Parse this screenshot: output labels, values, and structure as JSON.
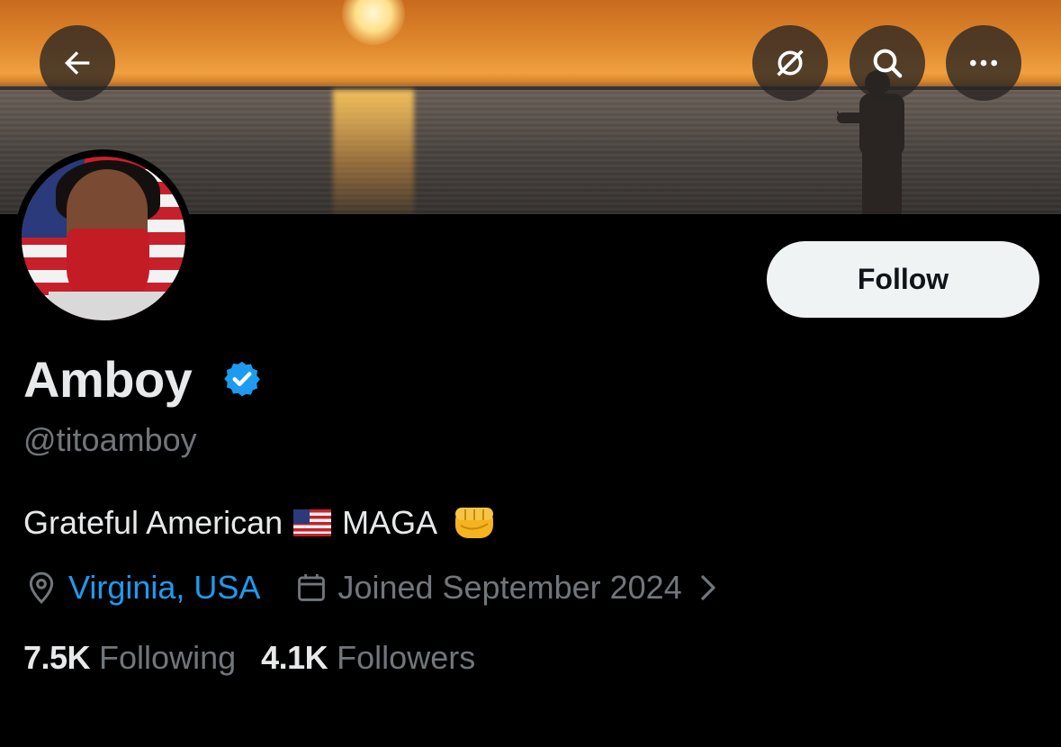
{
  "header": {
    "back_icon": "arrow-left-icon",
    "grok_icon": "grok-icon",
    "search_icon": "search-icon",
    "more_icon": "more-horizontal-icon"
  },
  "profile": {
    "display_name": "Amboy",
    "verified": true,
    "handle": "@titoamboy",
    "follow_label": "Follow",
    "bio_part1": "Grateful American",
    "bio_part2": "MAGA",
    "location": "Virginia, USA",
    "joined": "Joined September 2024",
    "following_count": "7.5K",
    "following_label": "Following",
    "followers_count": "4.1K",
    "followers_label": "Followers"
  },
  "colors": {
    "accent": "#1d9bf0",
    "muted": "#71767b",
    "text": "#e7e9ea",
    "background": "#000000",
    "follow_bg": "#eff3f4"
  }
}
